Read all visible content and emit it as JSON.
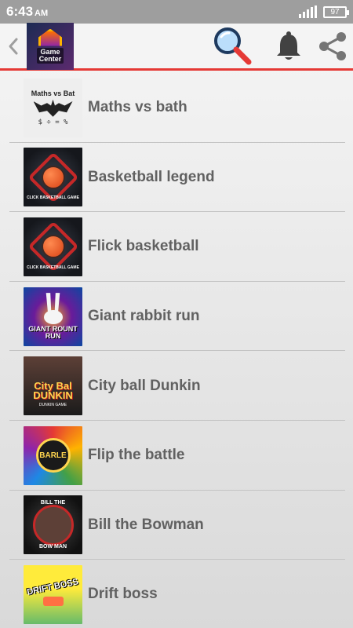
{
  "status_bar": {
    "time": "6:43",
    "ampm": "AM",
    "battery": "97"
  },
  "header": {
    "logo_text_line1": "Game",
    "logo_text_line2": "Center",
    "icons": [
      "back-arrow-icon",
      "search-icon",
      "bell-icon",
      "share-icon"
    ],
    "accent_color": "#e53935"
  },
  "games": [
    {
      "title": "Maths vs bath",
      "thumb_caption": "Maths vs Bat",
      "thumb_extra": "$ ÷ = %"
    },
    {
      "title": "Basketball legend",
      "thumb_caption": "CLICK BASKETBALL GAME"
    },
    {
      "title": "Flick basketball",
      "thumb_caption": "CLICK BASKETBALL GAME"
    },
    {
      "title": "Giant rabbit run",
      "thumb_caption": "GIANT ROUNT RUN"
    },
    {
      "title": "City ball Dunkin",
      "thumb_caption": "City Bal DUNKIN",
      "thumb_extra": "DUNKIN GAME"
    },
    {
      "title": "Flip the battle",
      "thumb_caption": "BARLE"
    },
    {
      "title": "Bill the Bowman",
      "thumb_caption": "BILL THE",
      "thumb_extra": "BOW MAN"
    },
    {
      "title": "Drift boss",
      "thumb_caption": "DRIFT BOSS"
    }
  ]
}
